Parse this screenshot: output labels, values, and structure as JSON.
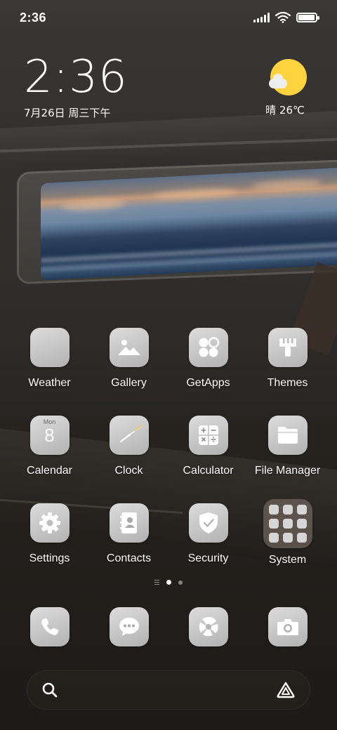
{
  "status_bar": {
    "time": "2:36",
    "icons": [
      "signal-icon",
      "wifi-icon",
      "battery-icon"
    ],
    "battery_level": 0.95
  },
  "clock_widget": {
    "time": "2:36",
    "date": "7月26日 周三下午"
  },
  "weather_widget": {
    "condition_icon": "sun-cloud-icon",
    "text": "晴 26℃"
  },
  "apps": [
    {
      "label": "Weather",
      "icon": "weather-icon"
    },
    {
      "label": "Gallery",
      "icon": "gallery-icon"
    },
    {
      "label": "GetApps",
      "icon": "getapps-icon"
    },
    {
      "label": "Themes",
      "icon": "themes-brush-icon"
    },
    {
      "label": "Calendar",
      "icon": "calendar-icon",
      "month": "Mon",
      "day": "8"
    },
    {
      "label": "Clock",
      "icon": "clock-icon"
    },
    {
      "label": "Calculator",
      "icon": "calculator-icon"
    },
    {
      "label": "File Manager",
      "icon": "folder-icon"
    },
    {
      "label": "Settings",
      "icon": "gear-icon"
    },
    {
      "label": "Contacts",
      "icon": "contacts-book-icon"
    },
    {
      "label": "Security",
      "icon": "shield-icon"
    },
    {
      "label": "System",
      "icon": "app-folder-icon"
    }
  ],
  "page_indicator": {
    "pages": 2,
    "current": 1
  },
  "dock": [
    {
      "icon": "phone-icon"
    },
    {
      "icon": "messages-icon"
    },
    {
      "icon": "browser-icon"
    },
    {
      "icon": "camera-icon"
    }
  ],
  "search_bar": {
    "left_icon": "search-icon",
    "right_icon": "assistant-icon"
  },
  "colors": {
    "sun": "#ffd33d",
    "icon_gradient_start": "#dcdcdc",
    "icon_gradient_end": "#b2b2b2"
  }
}
